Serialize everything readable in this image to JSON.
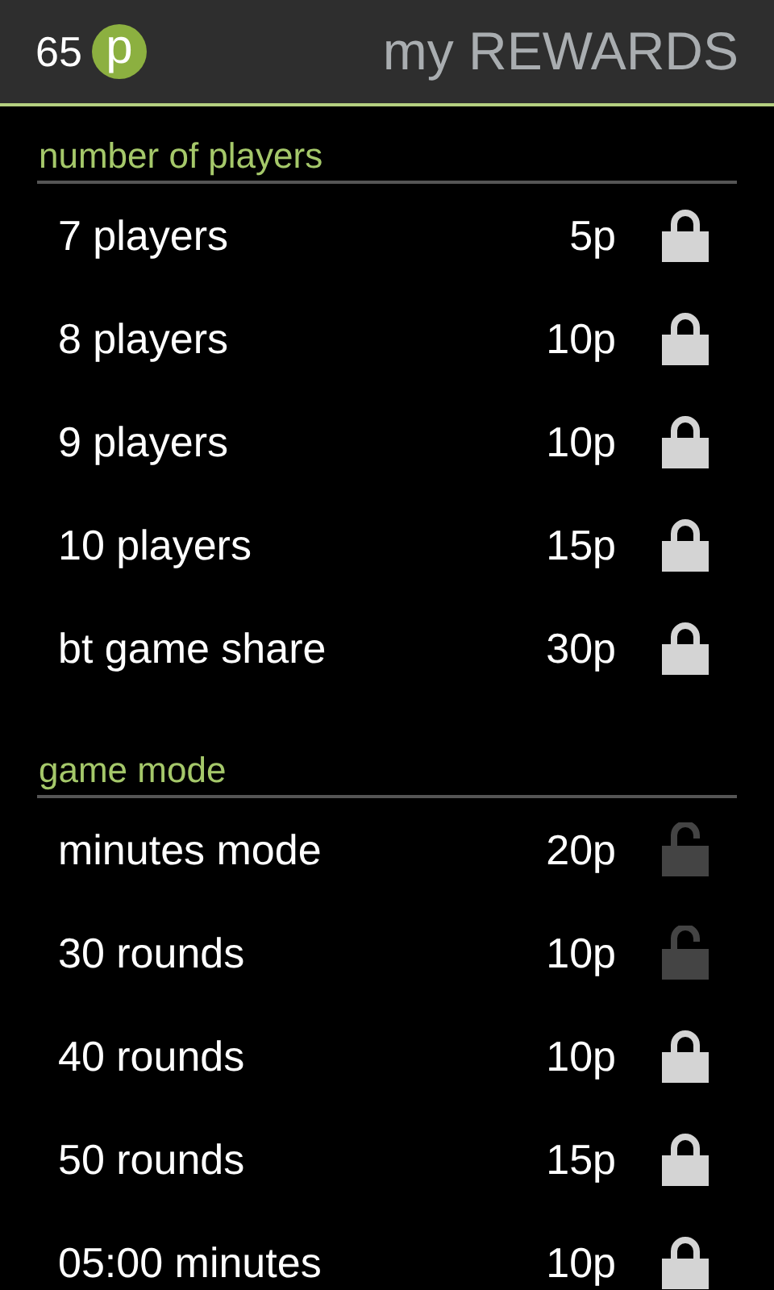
{
  "header": {
    "points": "65",
    "points_badge": "p",
    "title": "my REWARDS"
  },
  "sections": [
    {
      "title": "number of players",
      "items": [
        {
          "label": "7 players",
          "price": "5p",
          "locked": true
        },
        {
          "label": "8 players",
          "price": "10p",
          "locked": true
        },
        {
          "label": "9 players",
          "price": "10p",
          "locked": true
        },
        {
          "label": "10 players",
          "price": "15p",
          "locked": true
        },
        {
          "label": "bt game share",
          "price": "30p",
          "locked": true
        }
      ]
    },
    {
      "title": "game mode",
      "items": [
        {
          "label": "minutes mode",
          "price": "20p",
          "locked": false
        },
        {
          "label": "30 rounds",
          "price": "10p",
          "locked": false
        },
        {
          "label": "40 rounds",
          "price": "10p",
          "locked": true
        },
        {
          "label": "50 rounds",
          "price": "15p",
          "locked": true
        },
        {
          "label": "05:00 minutes",
          "price": "10p",
          "locked": true
        }
      ]
    }
  ]
}
